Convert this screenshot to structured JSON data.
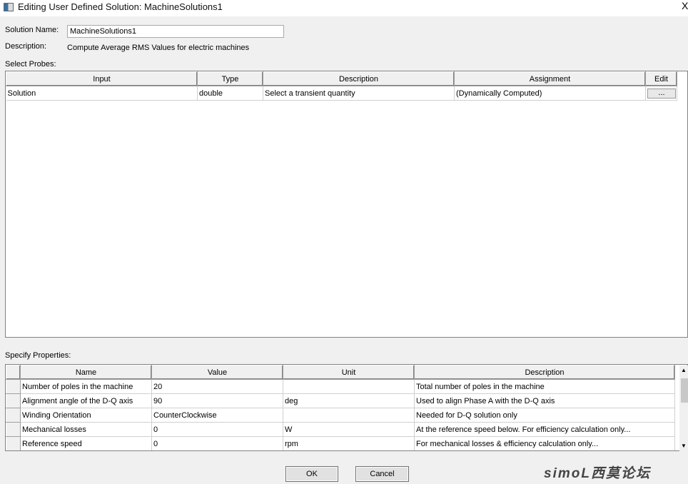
{
  "window": {
    "title": "Editing User Defined Solution: MachineSolutions1",
    "close": "X"
  },
  "form": {
    "solution_name_label": "Solution Name:",
    "solution_name_value": "MachineSolutions1",
    "description_label": "Description:",
    "description_value": "Compute Average  RMS Values for electric machines",
    "select_probes_label": "Select Probes:",
    "specify_properties_label": "Specify Properties:"
  },
  "probes": {
    "columns": [
      "Input",
      "Type",
      "Description",
      "Assignment",
      "Edit"
    ],
    "rows": [
      {
        "input": "Solution",
        "type": "double",
        "description": "Select a transient quantity",
        "assignment": "(Dynamically Computed)",
        "edit": "..."
      }
    ]
  },
  "properties": {
    "columns": [
      "Name",
      "Value",
      "Unit",
      "Description"
    ],
    "rows": [
      {
        "name": "Number of poles in the machine",
        "value": "20",
        "unit": "",
        "description": "Total number of poles in the machine"
      },
      {
        "name": "Alignment angle of the D-Q axis",
        "value": "90",
        "unit": "deg",
        "description": "Used to align Phase A with the D-Q axis"
      },
      {
        "name": "Winding Orientation",
        "value": "CounterClockwise",
        "unit": "",
        "description": "Needed for D-Q solution only"
      },
      {
        "name": "Mechanical losses",
        "value": "0",
        "unit": "W",
        "description": "At the reference speed below. For efficiency calculation only..."
      },
      {
        "name": "Reference speed",
        "value": "0",
        "unit": "rpm",
        "description": "For mechanical losses & efficiency calculation only..."
      }
    ]
  },
  "buttons": {
    "ok": "OK",
    "cancel": "Cancel"
  },
  "watermark": "simoL西莫论坛"
}
